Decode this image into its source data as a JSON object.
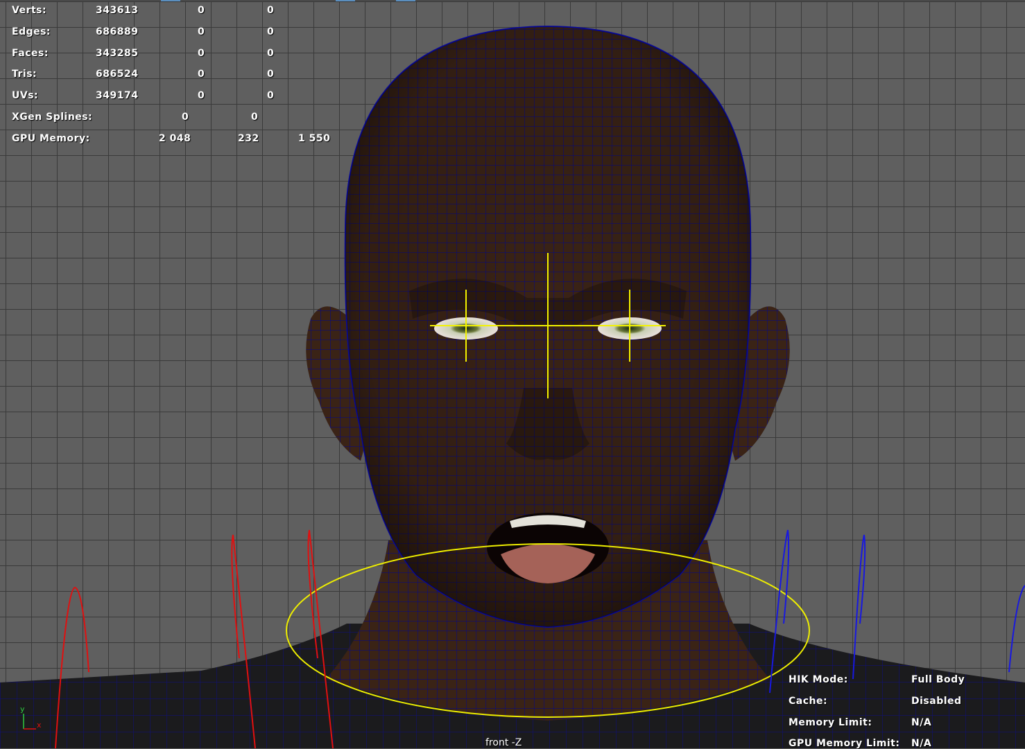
{
  "stats": {
    "rows": [
      {
        "label": "Verts:",
        "v1": "343613",
        "v2": "0",
        "v3": "0"
      },
      {
        "label": "Edges:",
        "v1": "686889",
        "v2": "0",
        "v3": "0"
      },
      {
        "label": "Faces:",
        "v1": "343285",
        "v2": "0",
        "v3": "0"
      },
      {
        "label": "Tris:",
        "v1": "686524",
        "v2": "0",
        "v3": "0"
      },
      {
        "label": "UVs:",
        "v1": "349174",
        "v2": "0",
        "v3": "0"
      }
    ],
    "xgen": {
      "label": "XGen Splines:",
      "v1": "0",
      "v2": "0"
    },
    "gpu": {
      "label": "GPU Memory:",
      "v1": "2 048",
      "v2": "232",
      "v3": "1 550"
    }
  },
  "hik": {
    "rows": [
      {
        "label": "HIK Mode:",
        "value": "Full Body"
      },
      {
        "label": "Cache:",
        "value": "Disabled"
      },
      {
        "label": "Memory Limit:",
        "value": "N/A"
      },
      {
        "label": "GPU Memory Limit:",
        "value": "N/A"
      }
    ]
  },
  "camera": {
    "label": "front -Z"
  },
  "axis": {
    "y": "y",
    "x": "x"
  },
  "colors": {
    "wire": "#0a0a8c",
    "skin": "#3d2416",
    "selection": "#ffff00",
    "axis_red": "#e01010",
    "axis_blue": "#1010e0"
  }
}
